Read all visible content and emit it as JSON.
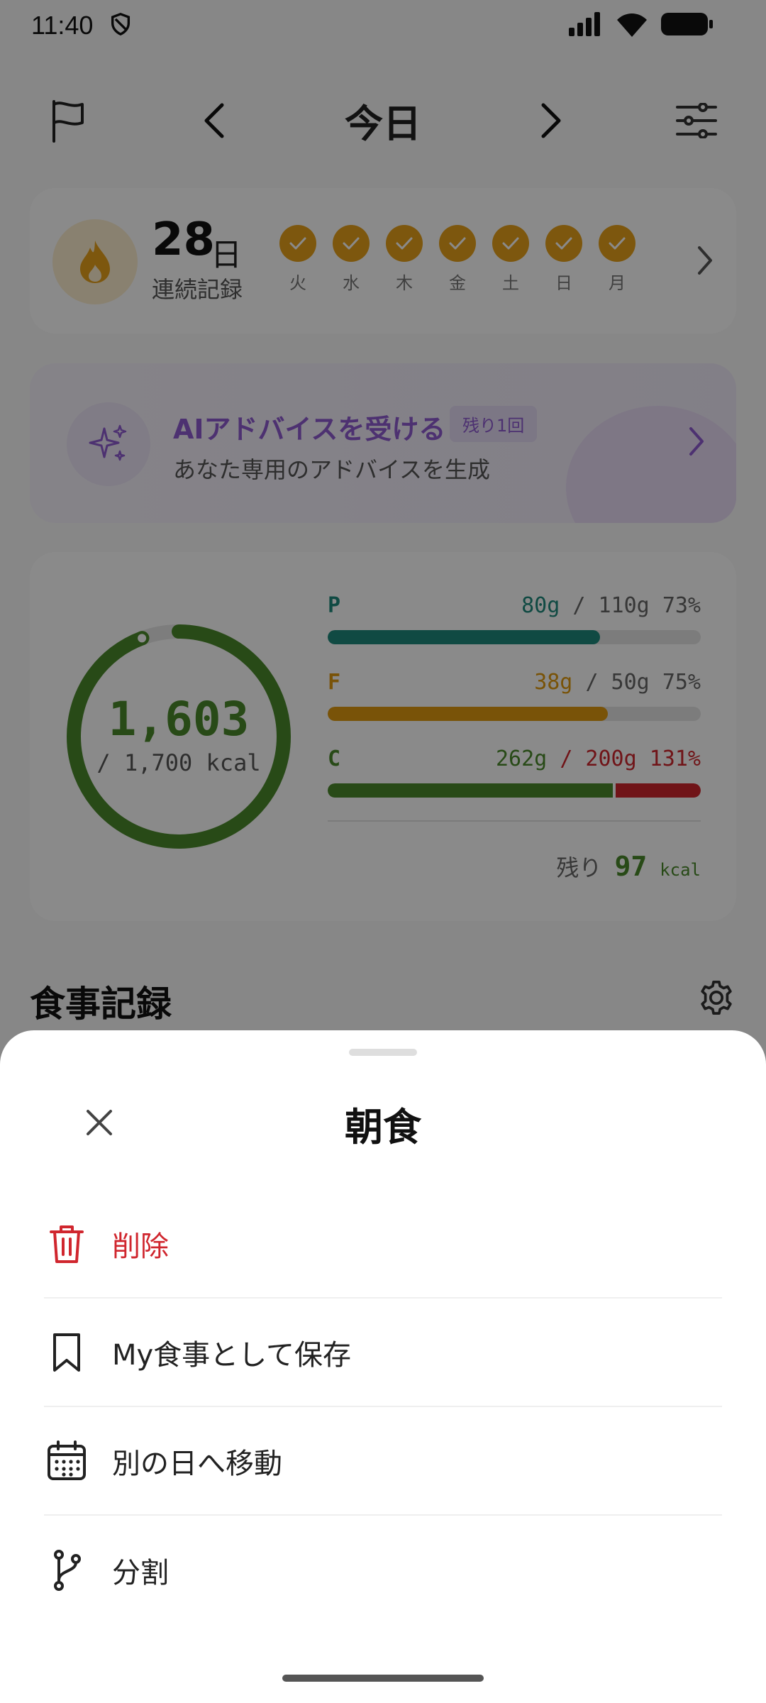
{
  "status": {
    "time": "11:40",
    "icons": [
      "shield-icon",
      "signal-icon",
      "wifi-icon",
      "battery-icon"
    ]
  },
  "header": {
    "title": "今日",
    "icons": [
      "flag-icon",
      "chevron-left-icon",
      "chevron-right-icon",
      "filter-sliders-icon"
    ]
  },
  "streak": {
    "count": "28",
    "unit": "日",
    "label": "連続記録",
    "days": [
      "火",
      "水",
      "木",
      "金",
      "土",
      "日",
      "月"
    ],
    "accent": "#e8a11a"
  },
  "ai": {
    "title": "AIアドバイスを受ける",
    "badge": "残り1回",
    "subtitle": "あなた専用のアドバイスを生成",
    "accent": "#8e5bd1"
  },
  "nutrition": {
    "calories": "1,603",
    "calories_target": "/ 1,700 kcal",
    "calories_ratio": 0.943,
    "macros": [
      {
        "letter": "P",
        "value": "80g",
        "target": "/ 110g",
        "percent": "73%",
        "ratio": 0.73,
        "color": "#1f8a7c",
        "over": false
      },
      {
        "letter": "F",
        "value": "38g",
        "target": "/ 50g",
        "percent": "75%",
        "ratio": 0.75,
        "color": "#e09a10",
        "over": false
      },
      {
        "letter": "C",
        "value": "262g",
        "target": "/ 200g",
        "percent": "131%",
        "ratio": 1.31,
        "color": "#4b8a2b",
        "over": true
      }
    ],
    "remaining_label": "残り",
    "remaining_value": "97",
    "remaining_unit": "kcal"
  },
  "section": {
    "title": "食事記録"
  },
  "sheet": {
    "title": "朝食",
    "items": [
      {
        "label": "削除",
        "icon": "trash-icon"
      },
      {
        "label": "My食事として保存",
        "icon": "bookmark-icon"
      },
      {
        "label": "別の日へ移動",
        "icon": "calendar-icon"
      },
      {
        "label": "分割",
        "icon": "split-branch-icon"
      }
    ]
  },
  "colors": {
    "danger": "#d0262e",
    "protein": "#1f8a7c",
    "fat": "#e09a10",
    "carb": "#4b8a2b"
  }
}
